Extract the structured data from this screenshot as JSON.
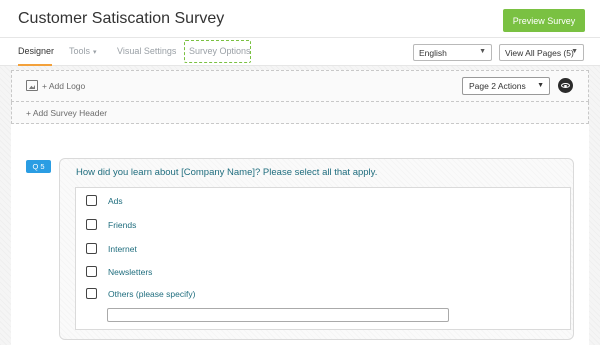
{
  "header": {
    "title": "Customer Satiscation Survey",
    "preview_label": "Preview Survey",
    "accent_color": "#7ac142"
  },
  "tabs": [
    {
      "label": "Designer",
      "active": true
    },
    {
      "label": "Tools",
      "has_dropdown": true
    },
    {
      "label": "Visual Settings"
    },
    {
      "label": "Survey Options",
      "highlighted": true
    }
  ],
  "language_select": {
    "value": "English"
  },
  "pages_select": {
    "value": "View All Pages (5)"
  },
  "canvas": {
    "add_logo_label": "+ Add Logo",
    "page_actions_label": "Page 2 Actions",
    "add_header_label": "+ Add Survey Header"
  },
  "question": {
    "badge": "Q 5",
    "text": "How did you learn about [Company Name]? Please select all that apply.",
    "options": [
      {
        "label": "Ads"
      },
      {
        "label": "Friends"
      },
      {
        "label": "Internet"
      },
      {
        "label": "Newsletters"
      },
      {
        "label": "Others (please specify)"
      }
    ],
    "other_value": ""
  }
}
